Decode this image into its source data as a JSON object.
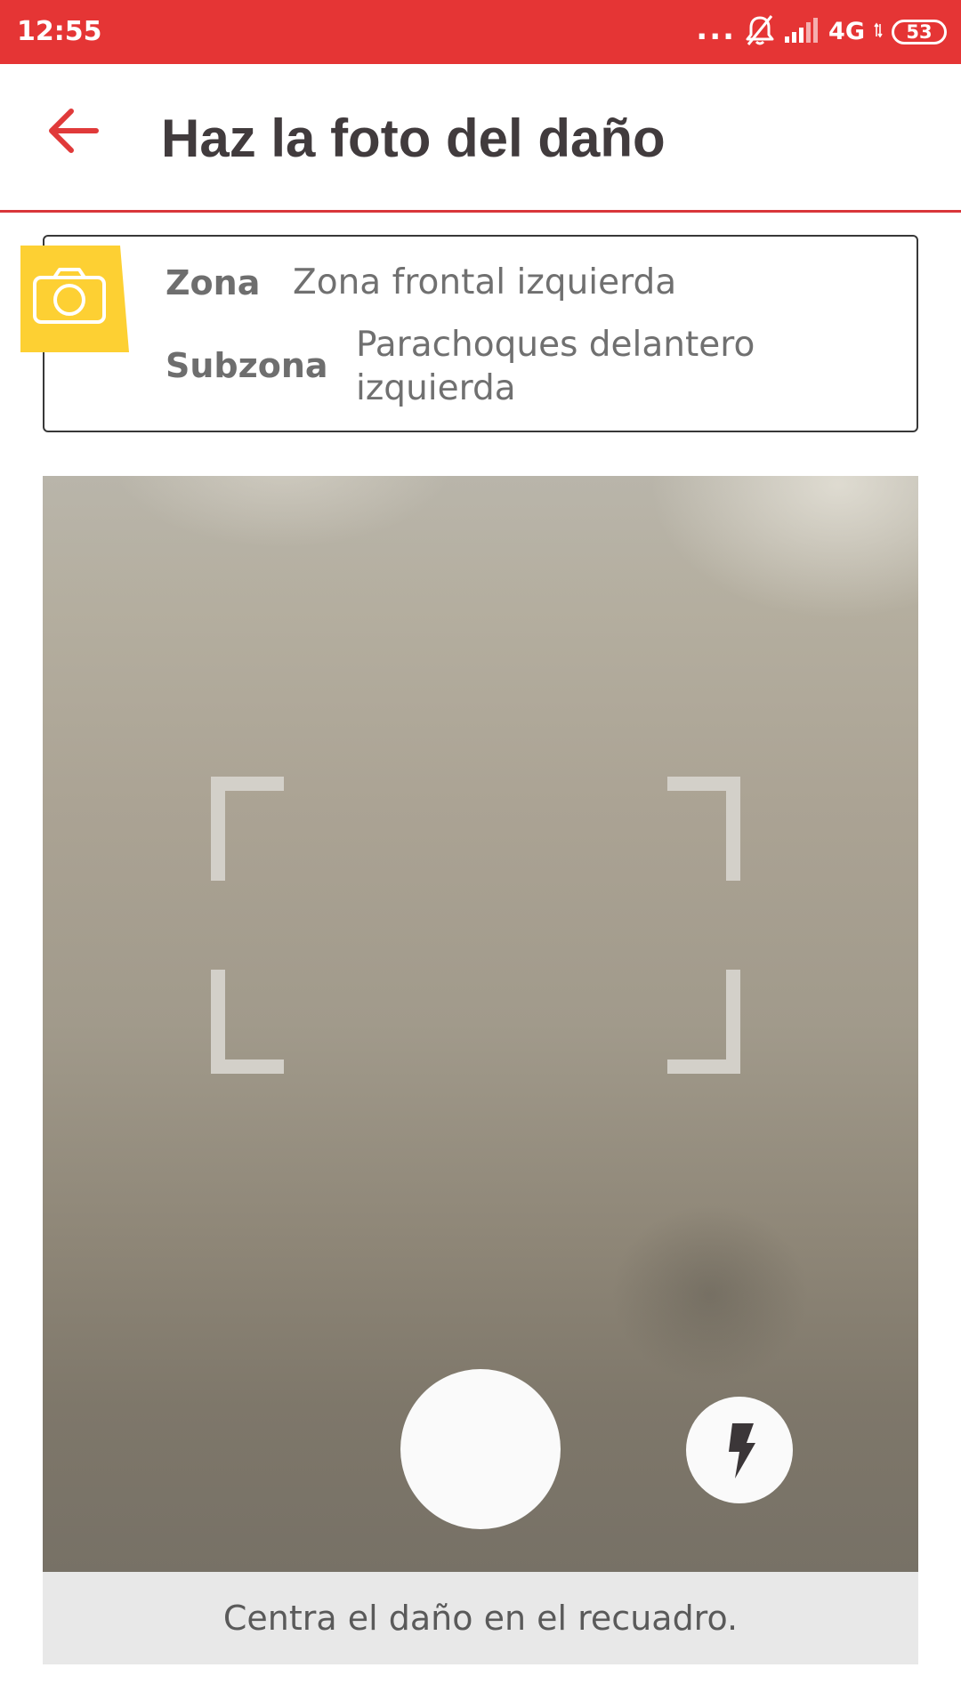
{
  "status_bar": {
    "time": "12:55",
    "dots": "...",
    "network": "4G",
    "battery": "53",
    "icons": [
      "notifications-off-icon",
      "signal-icon",
      "battery-icon"
    ]
  },
  "header": {
    "back_icon": "arrow-left-icon",
    "title": "Haz la foto del daño"
  },
  "info_card": {
    "badge_icon": "camera-icon",
    "zona_label": "Zona",
    "zona_value": "Zona frontal izquierda",
    "subzona_label": "Subzona",
    "subzona_value_line1": "Parachoques delantero",
    "subzona_value_line2": "izquierda"
  },
  "camera": {
    "frame_icon": "viewfinder-frame",
    "shutter_icon": "shutter-button",
    "flash_icon": "flash-icon"
  },
  "hint": {
    "text": "Centra el daño en el recuadro."
  },
  "colors": {
    "brand_red": "#e53535",
    "accent_yellow": "#fdd033",
    "title_text": "#413b3d"
  }
}
